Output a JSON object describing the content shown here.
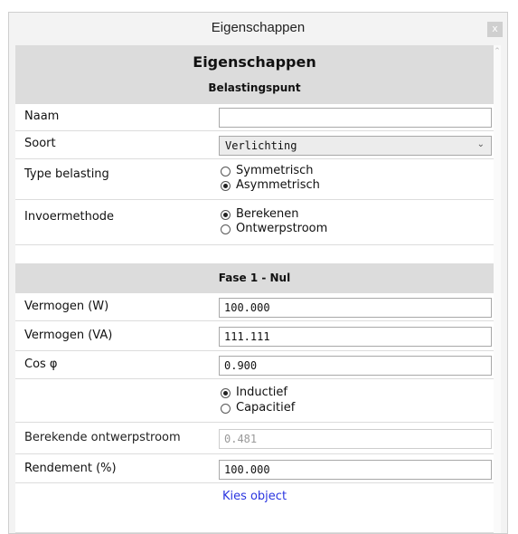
{
  "window": {
    "title": "Eigenschappen",
    "close_label": "x"
  },
  "header": {
    "title": "Eigenschappen",
    "subtitle": "Belastingspunt"
  },
  "fields": {
    "naam": {
      "label": "Naam",
      "value": ""
    },
    "soort": {
      "label": "Soort",
      "value": "Verlichting"
    },
    "type_belasting": {
      "label": "Type belasting",
      "options": [
        "Symmetrisch",
        "Asymmetrisch"
      ],
      "selected": "Asymmetrisch"
    },
    "invoermethode": {
      "label": "Invoermethode",
      "options": [
        "Berekenen",
        "Ontwerpstroom"
      ],
      "selected": "Berekenen"
    }
  },
  "section_fase": {
    "title": "Fase 1 - Nul"
  },
  "fase": {
    "vermogen_w": {
      "label": "Vermogen (W)",
      "value": "100.000"
    },
    "vermogen_va": {
      "label": "Vermogen (VA)",
      "value": "111.111"
    },
    "cos_phi": {
      "label": "Cos φ",
      "value": "0.900"
    },
    "karakter": {
      "options": [
        "Inductief",
        "Capacitief"
      ],
      "selected": "Inductief"
    },
    "ontwerpstroom": {
      "label": "Berekende ontwerpstroom",
      "value": "0.481"
    },
    "rendement": {
      "label": "Rendement (%)",
      "value": "100.000"
    }
  },
  "actions": {
    "kies_object": "Kies object"
  },
  "icons": {
    "close": "close-icon",
    "chevron": "chevron-down-icon",
    "scroll_up": "scroll-up-icon"
  }
}
